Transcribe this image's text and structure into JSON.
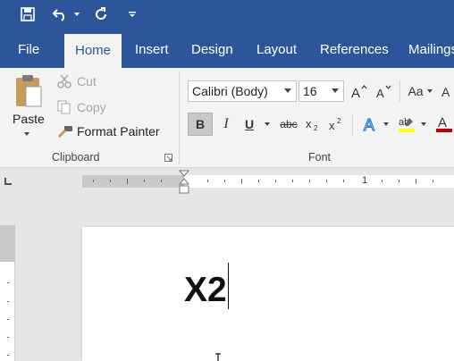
{
  "quick_access": {
    "save_icon": "save-icon",
    "undo_icon": "undo-icon",
    "redo_icon": "redo-icon",
    "customize_icon": "customize-qat-icon"
  },
  "tabs": [
    {
      "label": "File"
    },
    {
      "label": "Home",
      "active": true
    },
    {
      "label": "Insert"
    },
    {
      "label": "Design"
    },
    {
      "label": "Layout"
    },
    {
      "label": "References"
    },
    {
      "label": "Mailings"
    }
  ],
  "clipboard": {
    "paste_label": "Paste",
    "cut_label": "Cut",
    "copy_label": "Copy",
    "format_painter_label": "Format Painter",
    "group_label": "Clipboard"
  },
  "font": {
    "font_name": "Calibri (Body)",
    "font_size": "16",
    "group_label": "Font",
    "bold_label": "B",
    "italic_label": "I",
    "underline_label": "U",
    "strikethrough_label": "abc",
    "change_case_label": "Aa",
    "bold_active": true
  },
  "ruler": {
    "number_label": "1"
  },
  "document": {
    "text": "X2"
  },
  "colors": {
    "accent": "#2b579a",
    "highlight": "#ffff00",
    "font_color": "#c00000"
  }
}
